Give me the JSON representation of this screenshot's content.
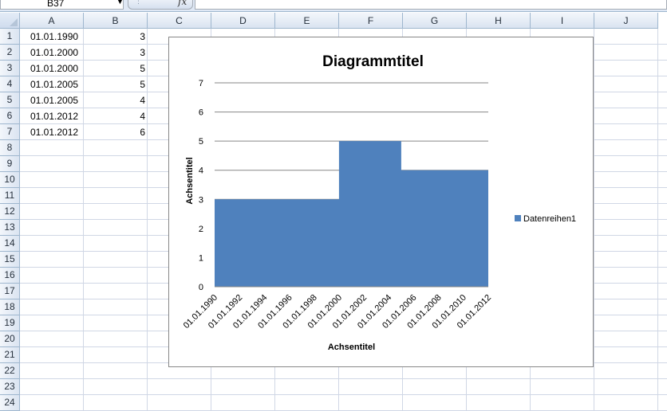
{
  "name_box": {
    "value": "B37"
  },
  "formula_bar": {
    "fx_label": "fx",
    "content": ""
  },
  "columns": [
    "A",
    "B",
    "C",
    "D",
    "E",
    "F",
    "G",
    "H",
    "I",
    "J"
  ],
  "rows": [
    "1",
    "2",
    "3",
    "4",
    "5",
    "6",
    "7",
    "8",
    "9",
    "10",
    "11",
    "12",
    "13",
    "14",
    "15",
    "16",
    "17",
    "18",
    "19",
    "20",
    "21",
    "22",
    "23",
    "24"
  ],
  "sheet_data": [
    {
      "a": "01.01.1990",
      "b": "3"
    },
    {
      "a": "01.01.2000",
      "b": "3"
    },
    {
      "a": "01.01.2000",
      "b": "5"
    },
    {
      "a": "01.01.2005",
      "b": "5"
    },
    {
      "a": "01.01.2005",
      "b": "4"
    },
    {
      "a": "01.01.2012",
      "b": "4"
    },
    {
      "a": "01.01.2012",
      "b": "6"
    }
  ],
  "colors": {
    "series": "#4f81bd",
    "gridline": "#878787",
    "header_bg": "#dfe8f5"
  },
  "chart_data": {
    "type": "area",
    "title": "Diagrammtitel",
    "xlabel": "Achsentitel",
    "ylabel": "Achsentitel",
    "x_ticks": [
      "01.01.1990",
      "01.01.1992",
      "01.01.1994",
      "01.01.1996",
      "01.01.1998",
      "01.01.2000",
      "01.01.2002",
      "01.01.2004",
      "01.01.2006",
      "01.01.2008",
      "01.01.2010",
      "01.01.2012"
    ],
    "y_ticks": [
      "0",
      "1",
      "2",
      "3",
      "4",
      "5",
      "6",
      "7"
    ],
    "ylim": [
      0,
      7
    ],
    "xlim": [
      "01.01.1990",
      "01.01.2012"
    ],
    "grid": true,
    "legend_position": "right",
    "series": [
      {
        "name": "Datenreihen1",
        "points": [
          {
            "x": "01.01.1990",
            "y": 3
          },
          {
            "x": "01.01.2000",
            "y": 3
          },
          {
            "x": "01.01.2000",
            "y": 5
          },
          {
            "x": "01.01.2005",
            "y": 5
          },
          {
            "x": "01.01.2005",
            "y": 4
          },
          {
            "x": "01.01.2012",
            "y": 4
          }
        ]
      }
    ]
  }
}
